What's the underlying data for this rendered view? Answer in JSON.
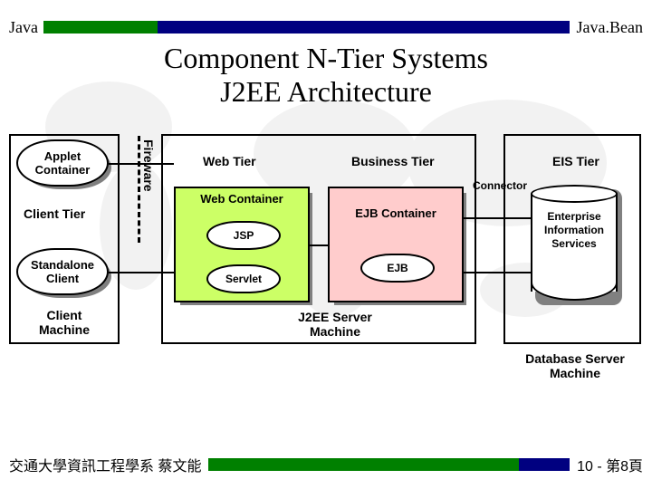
{
  "header": {
    "left": "Java",
    "right": "Java.Bean"
  },
  "title_l1": "Component N-Tier Systems",
  "title_l2": "J2EE Architecture",
  "client": {
    "applet": "Applet Container",
    "tier_label": "Client Tier",
    "standalone": "Standalone Client",
    "machine_label": "Client Machine"
  },
  "firewall_label": "Fireware",
  "web": {
    "tier_label": "Web Tier",
    "container_label": "Web Container",
    "jsp": "JSP",
    "servlet": "Servlet"
  },
  "business": {
    "tier_label": "Business Tier",
    "container_label": "EJB Container",
    "ejb": "EJB"
  },
  "connector_label": "Connector",
  "eis": {
    "tier_label": "EIS Tier",
    "cyl_label": "Enterprise Information Services"
  },
  "server_machine_label": "J2EE Server Machine",
  "db_machine_label": "Database Server Machine",
  "footer": {
    "left": "交通大學資訊工程學系 蔡文能",
    "right": "10 - 第8頁"
  }
}
